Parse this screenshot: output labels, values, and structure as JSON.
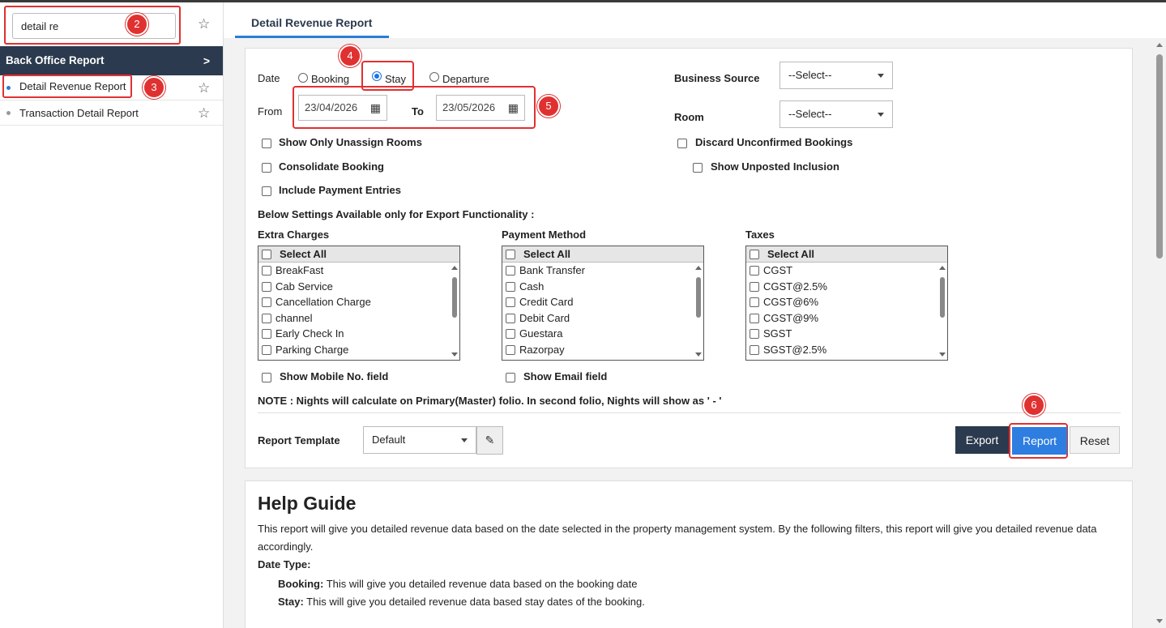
{
  "sidebar": {
    "search_value": "detail re",
    "header": "Back Office Report",
    "items": [
      {
        "label": "Detail Revenue Report",
        "active": true
      },
      {
        "label": "Transaction Detail Report",
        "active": false
      }
    ]
  },
  "tab": {
    "label": "Detail Revenue Report"
  },
  "form": {
    "date_label": "Date",
    "date_options": [
      "Booking",
      "Stay",
      "Departure"
    ],
    "date_selected": "Stay",
    "from_label": "From",
    "to_label": "To",
    "from_value": "23/04/2026",
    "to_value": "23/05/2026",
    "business_source_label": "Business Source",
    "business_source_value": "--Select--",
    "room_label": "Room",
    "room_value": "--Select--",
    "checkboxes": {
      "show_only_unassign": "Show Only Unassign Rooms",
      "consolidate": "Consolidate Booking",
      "include_payment": "Include Payment Entries",
      "discard_unconfirmed": "Discard Unconfirmed Bookings",
      "show_unposted": "Show Unposted Inclusion"
    },
    "export_settings_note": "Below Settings Available only for Export Functionality :",
    "select_all": "Select All",
    "extra_charges": {
      "title": "Extra Charges",
      "items": [
        "BreakFast",
        "Cab Service",
        "Cancellation Charge",
        "channel",
        "Early Check In",
        "Parking Charge"
      ]
    },
    "payment_method": {
      "title": "Payment Method",
      "items": [
        "Bank Transfer",
        "Cash",
        "Credit Card",
        "Debit Card",
        "Guestara",
        "Razorpay"
      ]
    },
    "taxes": {
      "title": "Taxes",
      "items": [
        "CGST",
        "CGST@2.5%",
        "CGST@6%",
        "CGST@9%",
        "SGST",
        "SGST@2.5%"
      ]
    },
    "show_mobile": "Show Mobile No. field",
    "show_email": "Show Email field",
    "note": "NOTE : Nights will calculate on Primary(Master) folio. In second folio, Nights will show as ' - '",
    "template_label": "Report Template",
    "template_value": "Default",
    "buttons": {
      "export": "Export",
      "report": "Report",
      "reset": "Reset"
    }
  },
  "help": {
    "title": "Help Guide",
    "intro": "This report will give you detailed revenue data based on the date selected in the property management system. By the following filters, this report will give you detailed revenue data accordingly.",
    "date_type_label": "Date Type:",
    "booking_term": "Booking:",
    "booking_desc": " This will give you detailed revenue data based on the booking date",
    "stay_term": "Stay:",
    "stay_desc": " This will give you detailed revenue data based stay dates of the booking."
  },
  "annotations": [
    "2",
    "3",
    "4",
    "5",
    "6"
  ],
  "colors": {
    "accent": "#2e7de0",
    "dark": "#2b3a4e",
    "highlight": "#e03131"
  },
  "icons": [
    "star-icon",
    "chevron-right-icon",
    "calendar-icon",
    "edit-icon",
    "dropdown-caret-icon"
  ]
}
